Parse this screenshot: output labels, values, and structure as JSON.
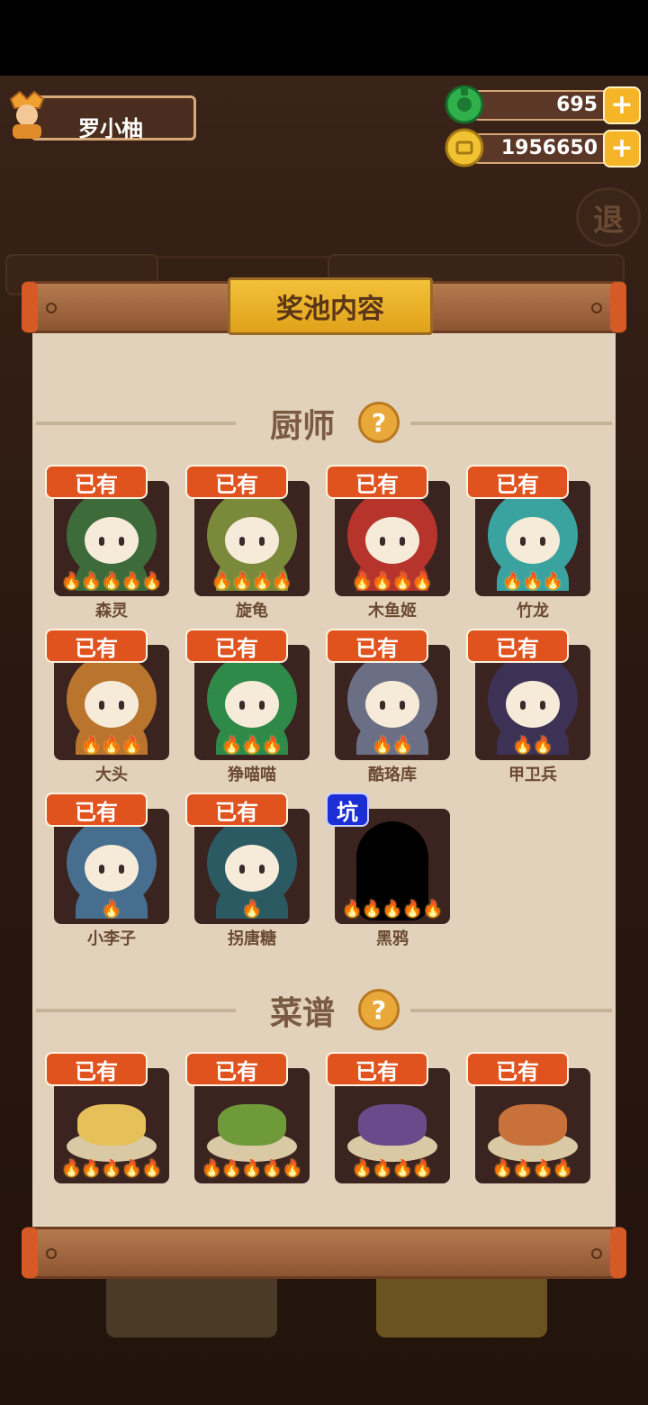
{
  "player": {
    "name": "罗小柚"
  },
  "resources": [
    {
      "name": "jade",
      "value": "695",
      "icon": "jade-icon",
      "color": "#2fb04a"
    },
    {
      "name": "coin",
      "value": "1956650",
      "icon": "coin-icon",
      "color": "#f1c232"
    }
  ],
  "background": {
    "exit_label": "退"
  },
  "panel": {
    "title": "奖池内容",
    "chef_section": {
      "title": "厨师",
      "help": "?"
    },
    "recipe_section": {
      "title": "菜谱",
      "help": "?"
    },
    "owned_label": "已有",
    "pit_label": "坑",
    "chefs": [
      {
        "name": "森灵",
        "stars": 5,
        "owned": true,
        "color": "#3e6b3a"
      },
      {
        "name": "旋龟",
        "stars": 4,
        "owned": true,
        "color": "#7b8a3a"
      },
      {
        "name": "木鱼姬",
        "stars": 4,
        "owned": true,
        "color": "#b7342c"
      },
      {
        "name": "竹龙",
        "stars": 3,
        "owned": true,
        "color": "#3aa3a0"
      },
      {
        "name": "大头",
        "stars": 3,
        "owned": true,
        "color": "#b9742e"
      },
      {
        "name": "狰喵喵",
        "stars": 3,
        "owned": true,
        "color": "#2f8a4a"
      },
      {
        "name": "酷珞库",
        "stars": 2,
        "owned": true,
        "color": "#6b6f85"
      },
      {
        "name": "甲卫兵",
        "stars": 2,
        "owned": true,
        "color": "#3d3255"
      },
      {
        "name": "小李子",
        "stars": 1,
        "owned": true,
        "color": "#476e8e"
      },
      {
        "name": "拐唐糖",
        "stars": 1,
        "owned": true,
        "color": "#2b5a62"
      },
      {
        "name": "黑鸦",
        "stars": 5,
        "owned": false,
        "color": "#000000"
      }
    ],
    "recipes": [
      {
        "stars": 5,
        "owned": true,
        "color": "#e6c15a"
      },
      {
        "stars": 5,
        "owned": true,
        "color": "#6f9a3a"
      },
      {
        "stars": 4,
        "owned": true,
        "color": "#6a4a8a"
      },
      {
        "stars": 4,
        "owned": true,
        "color": "#c9713a"
      }
    ]
  }
}
